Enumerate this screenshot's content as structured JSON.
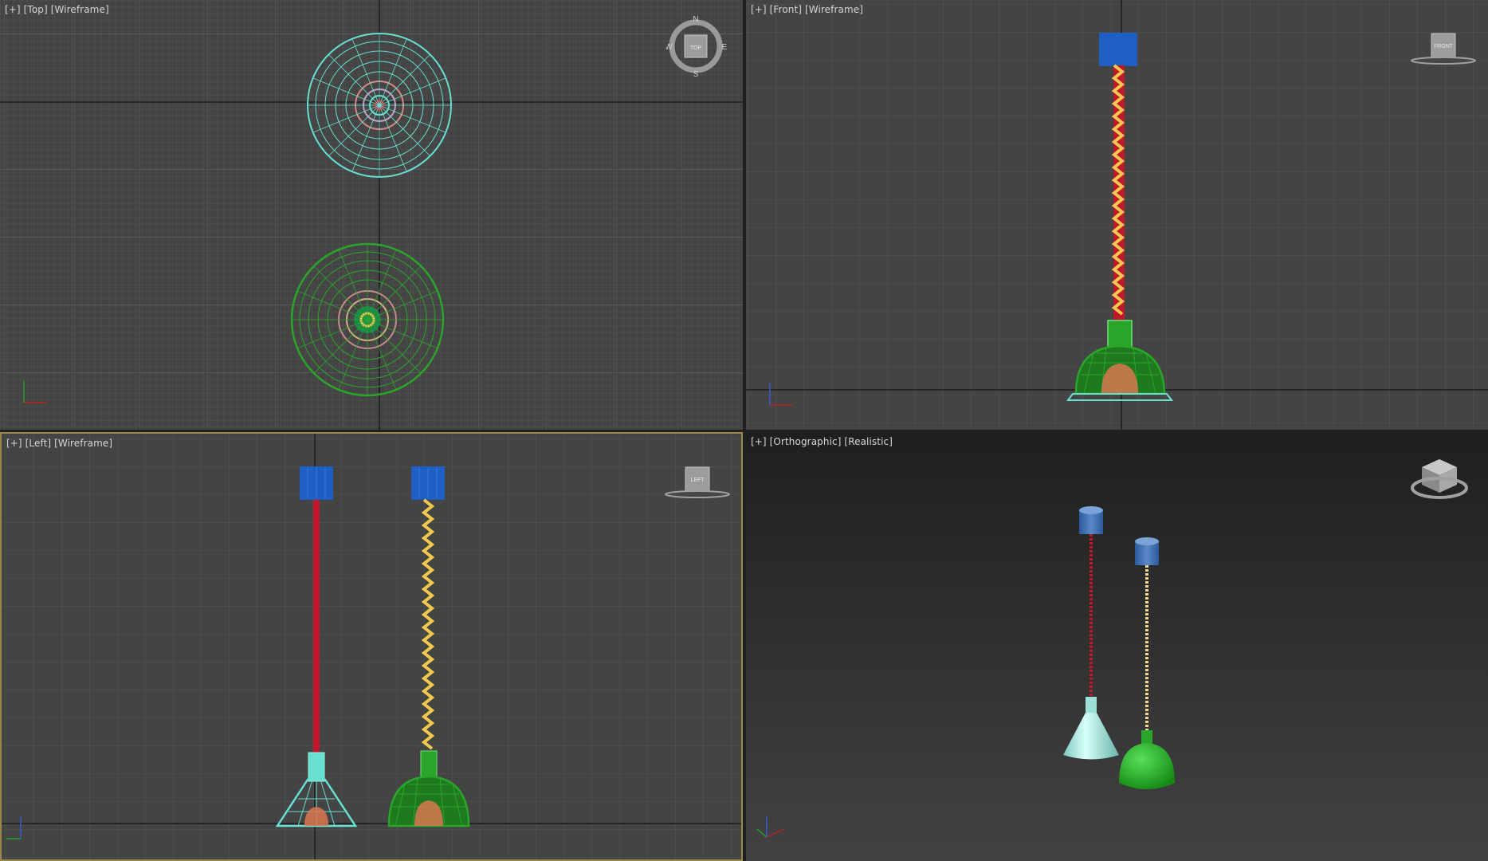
{
  "viewports": {
    "top": {
      "plus": "[+]",
      "view": "[Top]",
      "shading": "[Wireframe]"
    },
    "front": {
      "plus": "[+]",
      "view": "[Front]",
      "shading": "[Wireframe]"
    },
    "left": {
      "plus": "[+]",
      "view": "[Left]",
      "shading": "[Wireframe]"
    },
    "persp": {
      "plus": "[+]",
      "view": "[Orthographic]",
      "shading": "[Realistic]"
    }
  },
  "compass": {
    "n": "N",
    "s": "S",
    "e": "E",
    "w": "W",
    "cube_face": "TOP"
  },
  "navcube_faces": {
    "front": "FRONT",
    "left": "LEFT"
  },
  "colors": {
    "grid": "#555555",
    "axis_line": "#1c1c1c",
    "cyan_wire": "#66e0d0",
    "green_wire": "#2aa52a",
    "cap_blue": "#1f5fc4",
    "cord_red": "#c0182a",
    "cord_yellow": "#f0c850",
    "bulb": "#e0825a",
    "active_border": "#9a8a4a"
  }
}
